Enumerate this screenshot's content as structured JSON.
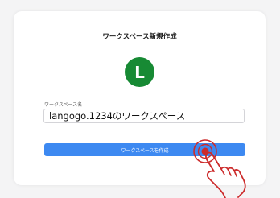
{
  "dialog": {
    "title": "ワークスペース新規作成",
    "avatar_letter": "L",
    "avatar_color": "#178a34",
    "field_label": "ワークスペース名",
    "input_value": "langogo.1234のワークスペース",
    "submit_label": "ワークスペースを作成",
    "submit_color": "#3d89f1"
  },
  "overlay": {
    "icon": "tap-hand-icon",
    "color": "#cc2b2b"
  }
}
